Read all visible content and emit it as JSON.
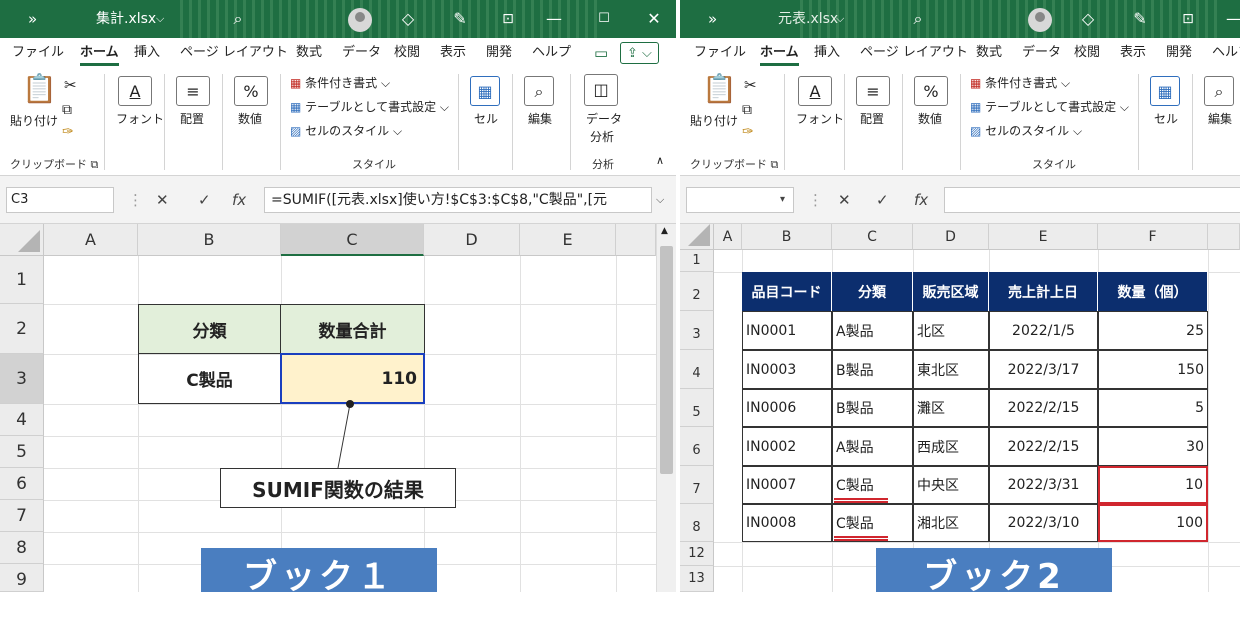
{
  "book1": {
    "title_bar": {
      "quick_access": "»",
      "file_name": "集計.xlsx",
      "title_chevron": "⌵",
      "search_icon": "search-icon",
      "gem_icon": "gem-icon",
      "pen_icon": "pen-icon",
      "restore_icon": "ribbon-display-icon",
      "minimize": "—",
      "maximize": "☐",
      "close": "✕"
    },
    "menu": [
      "ファイル",
      "ホーム",
      "挿入",
      "ページ レイアウト",
      "数式",
      "データ",
      "校閲",
      "表示",
      "開発",
      "ヘルプ"
    ],
    "menu_active": "ホーム",
    "ribbon": {
      "paste": "貼り付け",
      "font": "フォント",
      "align": "配置",
      "number": "数値",
      "cond_format": "条件付き書式 ⌵",
      "table_format": "テーブルとして書式設定 ⌵",
      "cell_styles": "セルのスタイル ⌵",
      "cells": "セル",
      "edit": "編集",
      "data_analysis_1": "データ",
      "data_analysis_2": "分析",
      "grp_clipboard": "クリップボード",
      "grp_style": "スタイル",
      "grp_analysis": "分析"
    },
    "formula_bar": {
      "name_box": "C3",
      "fx": "fx",
      "formula": "=SUMIF([元表.xlsx]使い方!$C$3:$C$8,\"C製品\",[元"
    },
    "columns": [
      "A",
      "B",
      "C",
      "D",
      "E"
    ],
    "rows": [
      "1",
      "2",
      "3",
      "4",
      "5",
      "6",
      "7",
      "8",
      "9"
    ],
    "table": {
      "header_category": "分類",
      "header_qty": "数量合計",
      "category": "C製品",
      "qty": "110"
    },
    "callout": "SUMIF関数の結果",
    "banner": "ブック１"
  },
  "book2": {
    "title_bar": {
      "quick_access": "»",
      "file_name": "元表.xlsx",
      "title_chevron": "⌵"
    },
    "menu": [
      "ファイル",
      "ホーム",
      "挿入",
      "ページ レイアウト",
      "数式",
      "データ",
      "校閲",
      "表示",
      "開発",
      "ヘルプ"
    ],
    "menu_active": "ホーム",
    "ribbon": {
      "paste": "貼り付け",
      "font": "フォント",
      "align": "配置",
      "number": "数値",
      "cond_format": "条件付き書式 ⌵",
      "table_format": "テーブルとして書式設定 ⌵",
      "cell_styles": "セルのスタイル ⌵",
      "cells": "セル",
      "edit": "編集",
      "grp_clipboard": "クリップボード",
      "grp_style": "スタイル"
    },
    "columns": [
      "A",
      "B",
      "C",
      "D",
      "E",
      "F"
    ],
    "rows": [
      "1",
      "2",
      "3",
      "4",
      "5",
      "6",
      "7",
      "8",
      "12",
      "13"
    ],
    "table": {
      "headers": [
        "品目コード",
        "分類",
        "販売区域",
        "売上計上日",
        "数量（個）"
      ],
      "rows": [
        [
          "IN0001",
          "A製品",
          "北区",
          "2022/1/5",
          "25"
        ],
        [
          "IN0003",
          "B製品",
          "東北区",
          "2022/3/17",
          "150"
        ],
        [
          "IN0006",
          "B製品",
          "灘区",
          "2022/2/15",
          "5"
        ],
        [
          "IN0002",
          "A製品",
          "西成区",
          "2022/2/15",
          "30"
        ],
        [
          "IN0007",
          "C製品",
          "中央区",
          "2022/3/31",
          "10"
        ],
        [
          "IN0008",
          "C製品",
          "湘北区",
          "2022/3/10",
          "100"
        ]
      ]
    },
    "banner": "ブック2"
  },
  "colors": {
    "excel_green": "#1e6e42",
    "header_navy": "#0c2e6e",
    "highlight_red": "#d0262e",
    "selection_blue": "#1a3fbf",
    "banner_blue": "#4a7ec0",
    "sheet_header_green": "#e2efda",
    "sheet_cell_cream": "#fff2cc"
  }
}
